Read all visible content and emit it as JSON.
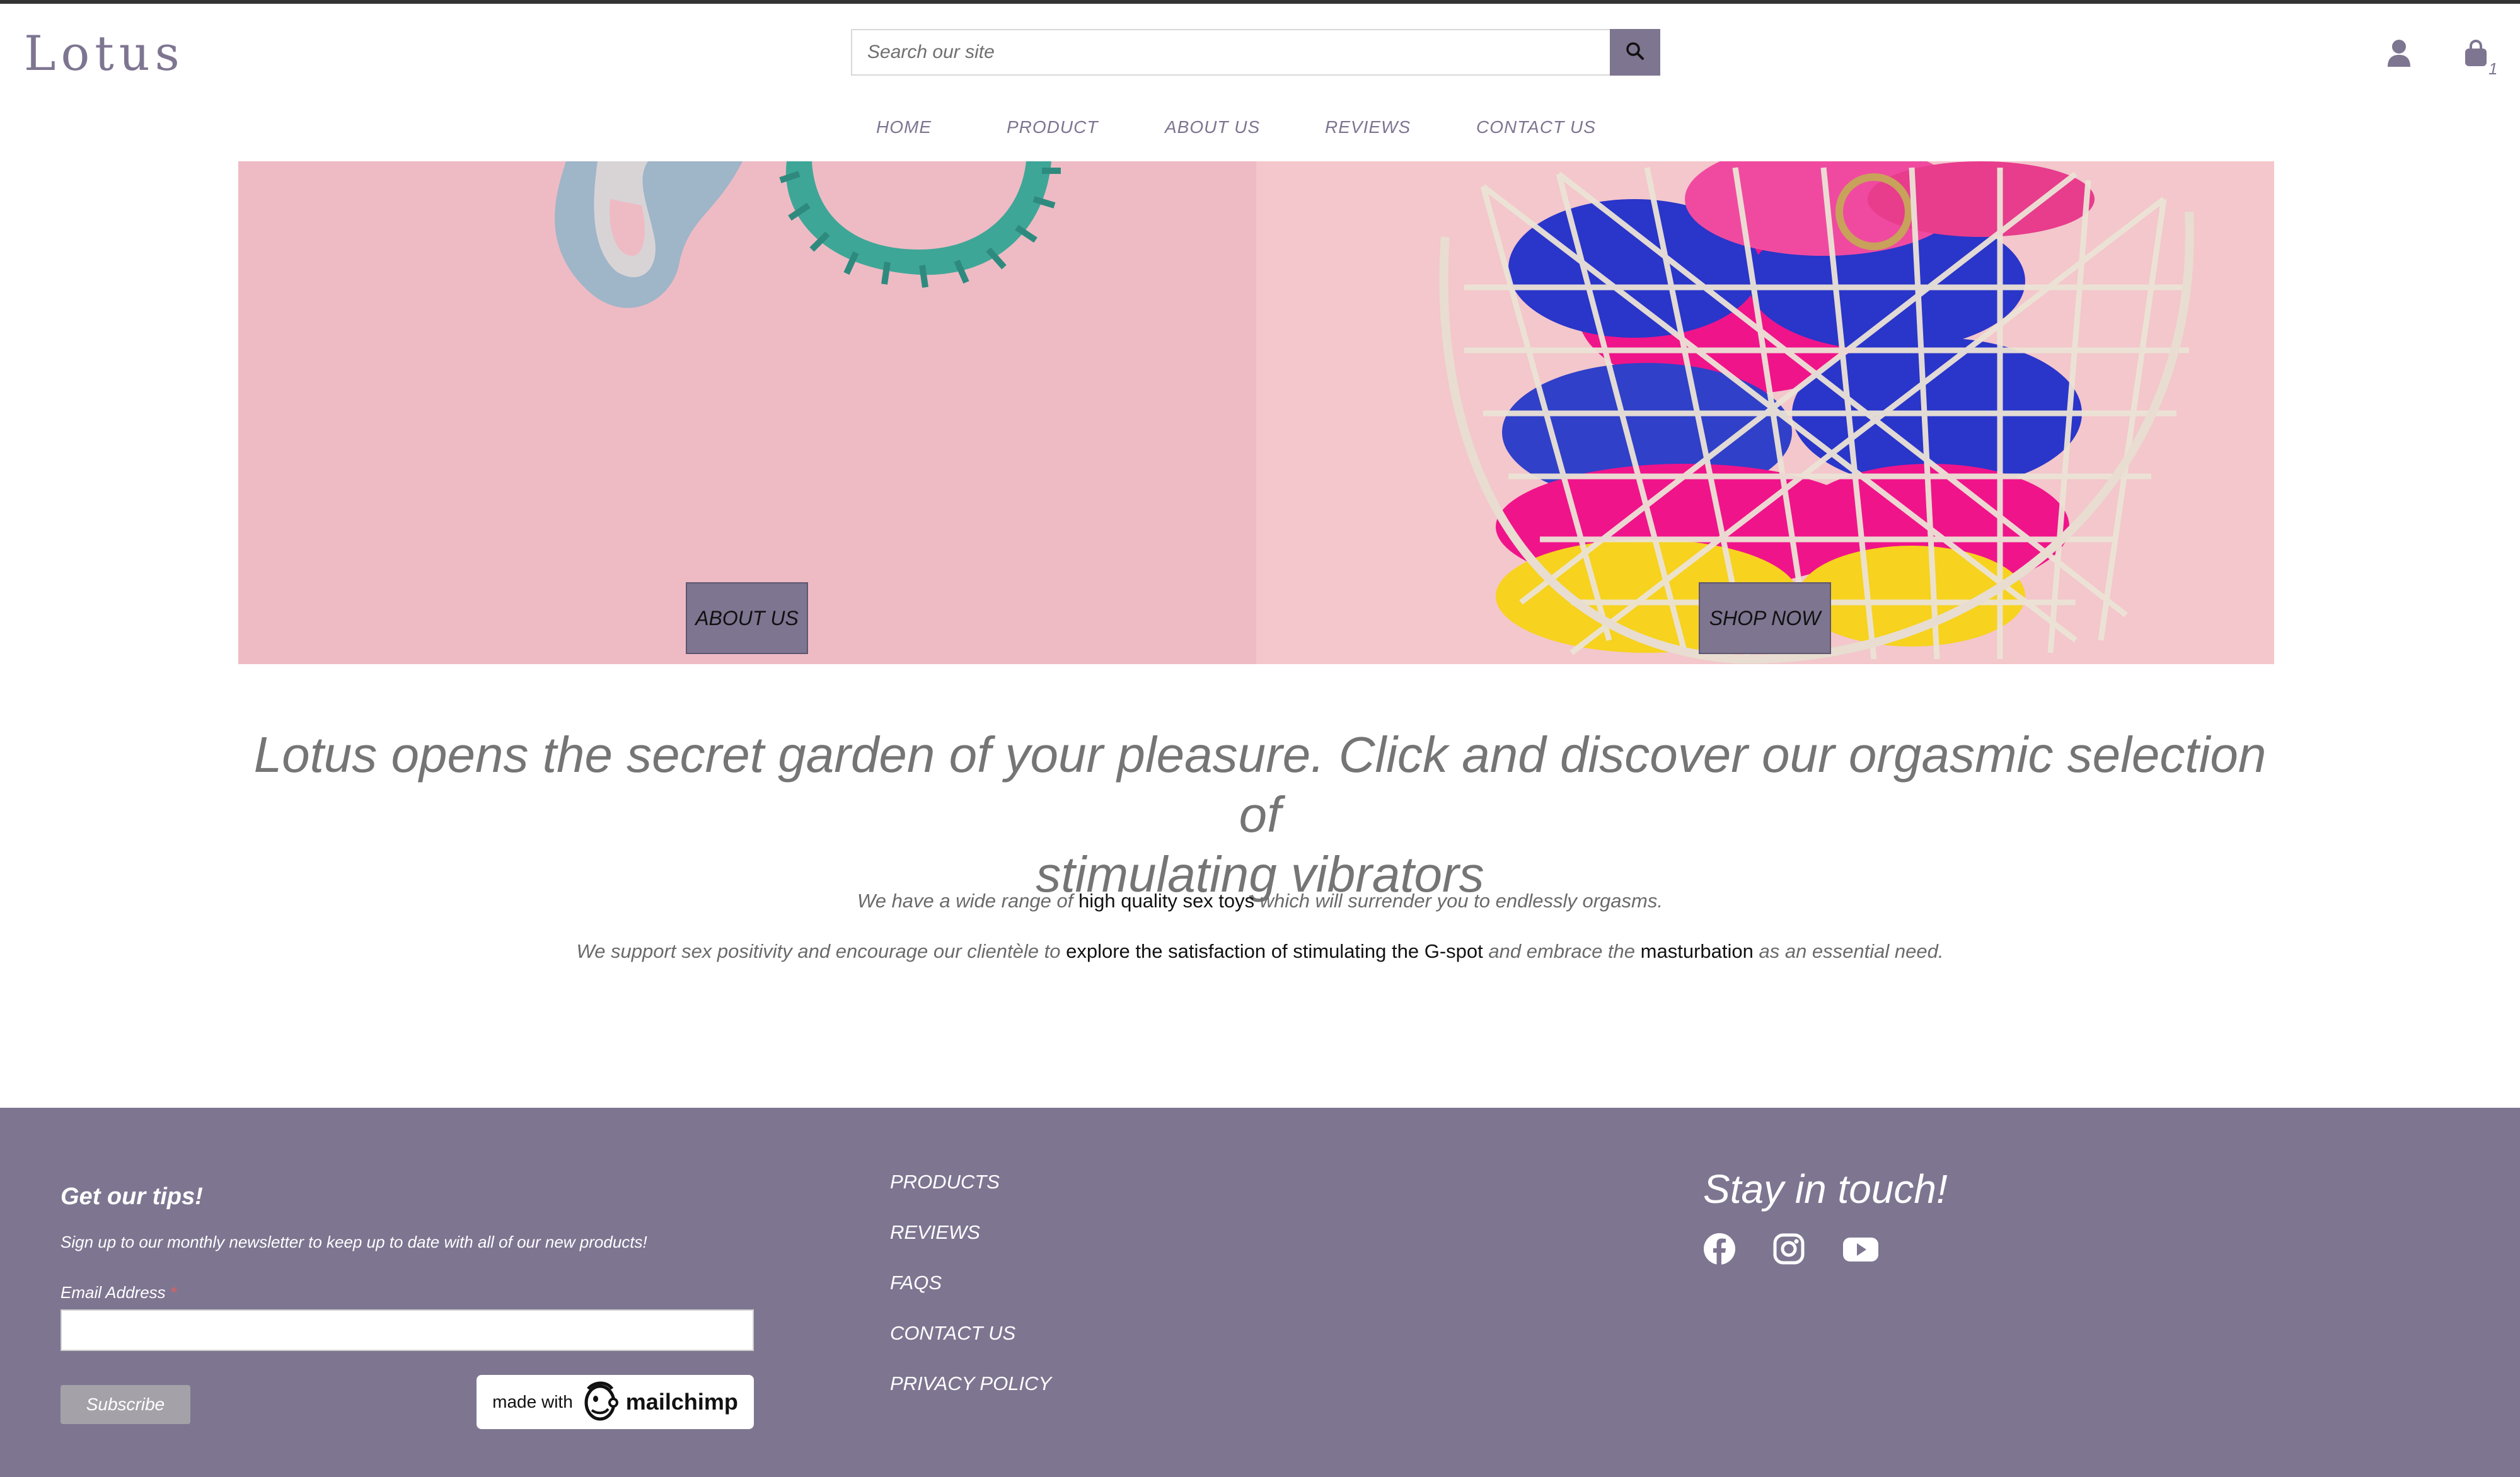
{
  "header": {
    "logo": "Lotus",
    "search_placeholder": "Search our site",
    "cart_count": "1"
  },
  "nav": [
    "HOME",
    "PRODUCT",
    "ABOUT US",
    "REVIEWS",
    "CONTACT US"
  ],
  "hero": {
    "left_button": "ABOUT US",
    "right_button": "SHOP NOW"
  },
  "content": {
    "headline_line1": "Lotus opens the secret garden of your pleasure. Click and discover our orgasmic selection of",
    "headline_line2": "stimulating vibrators",
    "p1_a": "We have a wide range of ",
    "p1_link": "high quality sex toys",
    "p1_b": " which will surrender you to endlessly orgasms.",
    "p2_a": "We support sex positivity and encourage our clientèle to ",
    "p2_link1": "explore the satisfaction of stimulating the G-spot",
    "p2_b": " and embrace the ",
    "p2_link2": "masturbation",
    "p2_c": " as an essential need."
  },
  "footer": {
    "newsletter_title": "Get our tips!",
    "newsletter_sub": "Sign up to our monthly newsletter to keep up to date with all of our new products!",
    "email_label": "Email Address",
    "required_mark": "*",
    "subscribe": "Subscribe",
    "made_with": "made with",
    "mailchimp": "mailchimp",
    "links": [
      "PRODUCTS",
      "REVIEWS",
      "FAQS",
      "CONTACT US",
      "PRIVACY POLICY"
    ],
    "stay_title": "Stay in touch!",
    "social": [
      "facebook-icon",
      "instagram-icon",
      "youtube-icon"
    ]
  },
  "colors": {
    "brand": "#7e7591",
    "hero_left_bg": "#eebbc4",
    "hero_right_bg": "#f3c7cb"
  }
}
